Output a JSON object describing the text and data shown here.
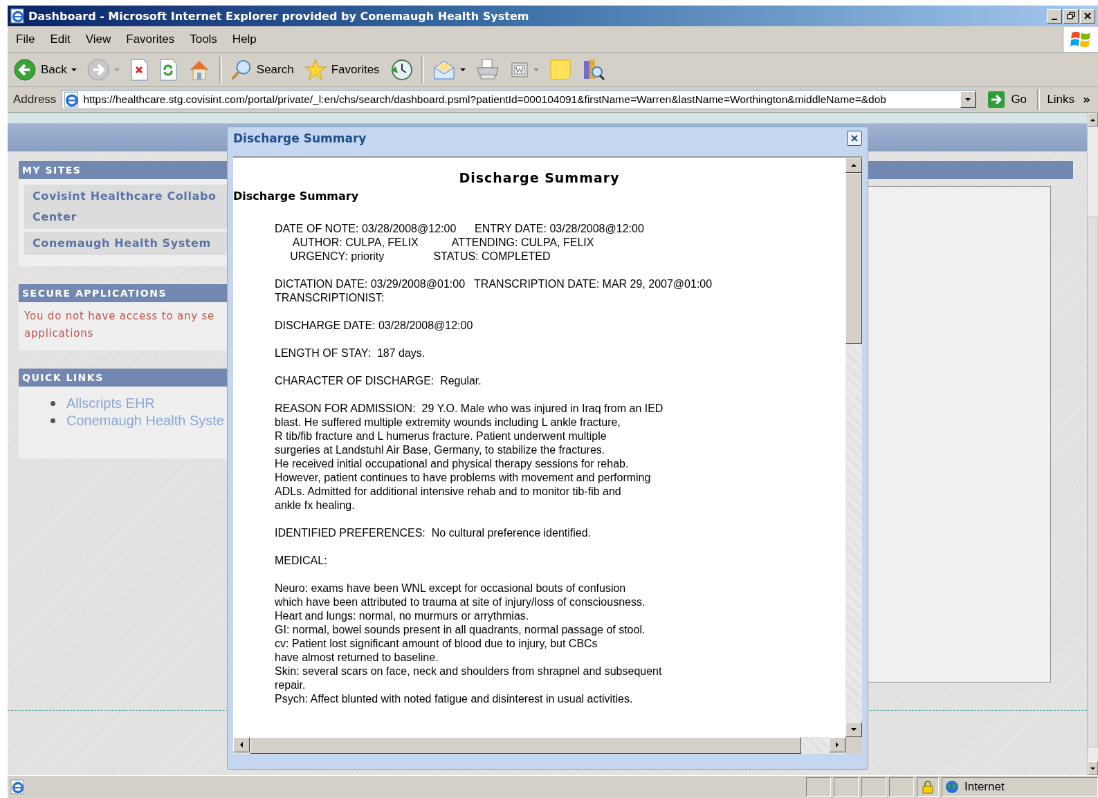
{
  "window": {
    "title": "Dashboard - Microsoft Internet Explorer provided by Conemaugh Health System"
  },
  "menu": [
    {
      "label": "File"
    },
    {
      "label": "Edit"
    },
    {
      "label": "View"
    },
    {
      "label": "Favorites"
    },
    {
      "label": "Tools"
    },
    {
      "label": "Help"
    }
  ],
  "toolbar": [
    {
      "kind": "back",
      "label": "Back"
    },
    {
      "kind": "forward"
    },
    {
      "kind": "stop"
    },
    {
      "kind": "refresh"
    },
    {
      "kind": "home"
    },
    {
      "kind": "separator"
    },
    {
      "kind": "search",
      "label": "Search"
    },
    {
      "kind": "favorites",
      "label": "Favorites"
    },
    {
      "kind": "history"
    },
    {
      "kind": "separator"
    },
    {
      "kind": "mail"
    },
    {
      "kind": "print"
    },
    {
      "kind": "edit"
    },
    {
      "kind": "note"
    },
    {
      "kind": "research"
    }
  ],
  "address": {
    "label": "Address",
    "value": "https://healthcare.stg.covisint.com/portal/private/_l:en/chs/search/dashboard.psml?patientId=000104091&firstName=Warren&lastName=Worthington&middleName=&dob",
    "go": "Go",
    "links": "Links",
    "more": "»"
  },
  "sidebar": [
    {
      "kind": "sites",
      "title": "MY SITES",
      "items": [
        {
          "lines": [
            "Covisint Healthcare Collabo",
            "Center"
          ]
        },
        {
          "lines": [
            "Conemaugh Health System"
          ]
        }
      ]
    },
    {
      "kind": "message",
      "title": "SECURE APPLICATIONS",
      "lines": [
        "You do not have access to any se",
        "applications"
      ]
    },
    {
      "kind": "links",
      "title": "QUICK LINKS",
      "items": [
        {
          "lines": [
            "Allscripts EHR"
          ]
        },
        {
          "lines": [
            "Conemaugh Health Syste"
          ]
        }
      ]
    }
  ],
  "dialog": {
    "title": "Discharge Summary",
    "heading": "Discharge Summary",
    "subheading": "Discharge Summary",
    "paragraphs": [
      [
        "DATE OF NOTE: 03/28/2008@12:00      ENTRY DATE: 03/28/2008@12:00",
        "      AUTHOR: CULPA, FELIX           ATTENDING: CULPA, FELIX",
        "     URGENCY: priority                STATUS: COMPLETED"
      ],
      [
        "DICTATION DATE: 03/29/2008@01:00   TRANSCRIPTION DATE: MAR 29, 2007@01:00",
        "TRANSCRIPTIONIST:"
      ],
      [
        "DISCHARGE DATE: 03/28/2008@12:00"
      ],
      [
        "LENGTH OF STAY:  187 days."
      ],
      [
        "CHARACTER OF DISCHARGE:  Regular."
      ],
      [
        "REASON FOR ADMISSION:  29 Y.O. Male who was injured in Iraq from an IED",
        "blast. He suffered multiple extremity wounds including L ankle fracture,",
        "R tib/fib fracture and L humerus fracture. Patient underwent multiple",
        "surgeries at Landstuhl Air Base, Germany, to stabilize the fractures.",
        "He received initial occupational and physical therapy sessions for rehab.",
        "However, patient continues to have problems with movement and performing",
        "ADLs. Admitted for additional intensive rehab and to monitor tib-fib and",
        "ankle fx healing."
      ],
      [
        "IDENTIFIED PREFERENCES:  No cultural preference identified."
      ],
      [
        "MEDICAL:"
      ],
      [
        "Neuro: exams have been WNL except for occasional bouts of confusion",
        "which have been attributed to trauma at site of injury/loss of consciousness.",
        "Heart and lungs: normal, no murmurs or arrythmias.",
        "GI: normal, bowel sounds present in all quadrants, normal passage of stool.",
        "cv: Patient lost significant amount of blood due to injury, but CBCs",
        "have almost returned to baseline.",
        "Skin: several scars on face, neck and shoulders from shrapnel and subsequent",
        "repair.",
        "Psych: Affect blunted with noted fatigue and disinterest in usual activities."
      ]
    ]
  },
  "status_bar": {
    "zone": "Internet"
  }
}
